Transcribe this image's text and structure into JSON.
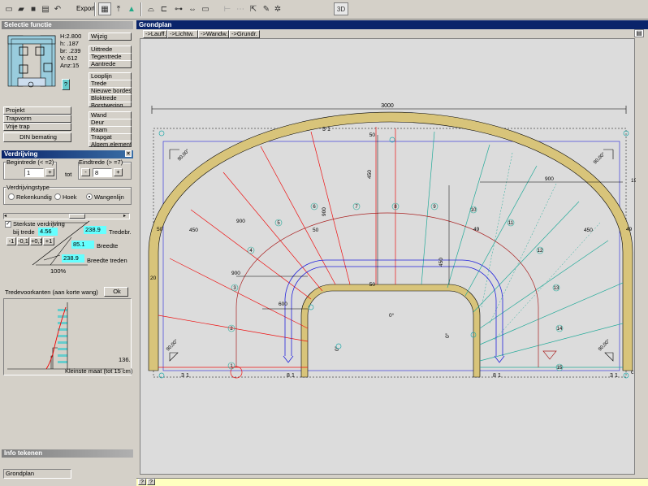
{
  "toolbar": {
    "export_label": "Export",
    "view3d_label": "3D"
  },
  "selectie": {
    "title": "Selectie functie",
    "dims": {
      "h": "H:2.800",
      "h_small": "h: .187",
      "br": "br: .239",
      "v": "V:  612",
      "anz": "Anz:15"
    },
    "question": "?",
    "buttons_a": [
      "Wijzig",
      "Uittrede",
      "Tegentrede",
      "Aantrede"
    ],
    "buttons_b": [
      "Looplijn",
      "Trede",
      "Nieuwe bordes",
      "Bloktrede",
      "Borstwering"
    ],
    "buttons_c": [
      "Wand",
      "Deur",
      "Raam",
      "Trapgat",
      "Algem.element"
    ],
    "buttons_left": [
      "Projekt",
      "Trapvorm",
      "Vrije trap"
    ],
    "din_label": "DIN bemating"
  },
  "verdrijving": {
    "title": "Verdrijving",
    "begintrede_label": "Begintrede (< =2)",
    "begintrede_value": "1",
    "eindtrede_label": "Eindtrede (> =7)",
    "eindtrede_value": "8",
    "tot_label": "tot",
    "minus": "-",
    "plus": "+",
    "type_label": "Verdrijvingstype",
    "types": [
      "Rekenkundig",
      "Hoek",
      "Wangenlijn"
    ],
    "selected_type": "Wangenlijn",
    "sterkste_label": "Sterkste verdrijving",
    "bij_trede_label": "bij trede",
    "bij_trede_value": "4.56",
    "steps": [
      "-1",
      "-0,1",
      "+0,1",
      "+1"
    ],
    "tredebr_value": "238.9",
    "tredebr_label": "Tredebr.",
    "breedte_value": "85.1",
    "breedte_label": "Breedte",
    "breedte_treden_value": "238.9",
    "breedte_treden_label": "Breedte treden",
    "percent": "100%",
    "voorkanten_label": "Tredevoorkanten (aan korte wang)",
    "ok_label": "Ok",
    "graph_value": "136.",
    "kleinste_label": "Kleinste maat (tot 15 cm)"
  },
  "info": {
    "title": "Info tekenen",
    "value": "Grondplan"
  },
  "drawing": {
    "title": "Grondplan",
    "tabs": [
      "->Lauff.",
      "->Lichtw.",
      "->Wandw.",
      "->Grundr."
    ],
    "status_btn": "?",
    "dims": {
      "total_width": "3000",
      "d50a": "50",
      "d450a": "450",
      "d900a": "900",
      "d50b": "50",
      "d450b": "450",
      "d900b": "900",
      "d450c": "450",
      "d450d": "450",
      "d49a": "49",
      "d49b": "49",
      "d19": "19",
      "d50c": "50",
      "d20": "20",
      "d900c": "900",
      "d600": "600",
      "d50d": "50",
      "d900d": "900"
    },
    "angles": [
      "90,00°",
      "90,00°",
      "90,00°",
      "90,00°"
    ],
    "zero_a": "0°",
    "zero_b": "0°",
    "zero_c": "0°",
    "step_numbers": [
      "1",
      "2",
      "3",
      "4",
      "5",
      "6",
      "7",
      "8",
      "9",
      "10",
      "11",
      "12",
      "13",
      "14",
      "15"
    ],
    "section_marks": [
      "3",
      "8",
      "8",
      "3",
      "3"
    ],
    "section_suffix": "1",
    "c_label": "c"
  }
}
